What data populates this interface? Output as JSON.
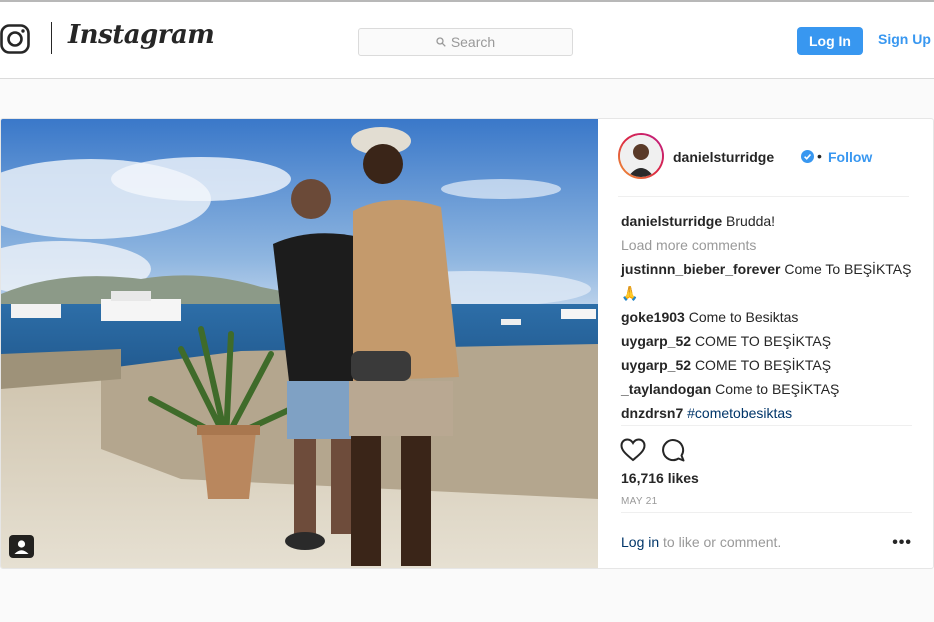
{
  "header": {
    "brand": "Instagram",
    "search_placeholder": "Search",
    "login_label": "Log In",
    "signup_label": "Sign Up"
  },
  "post": {
    "username": "danielsturridge",
    "verified": true,
    "follow_label": "Follow",
    "separator": "•",
    "load_more_label": "Load more comments",
    "comments": [
      {
        "user": "danielsturridge",
        "text": "Brudda!"
      },
      {
        "user": "justinnn_bieber_forever",
        "text": "Come To BEŞİKTAŞ 🙏"
      },
      {
        "user": "goke1903",
        "text": "Come to Besiktas"
      },
      {
        "user": "uygarp_52",
        "text": "COME TO BEŞİKTAŞ"
      },
      {
        "user": "uygarp_52",
        "text": "COME TO BEŞİKTAŞ"
      },
      {
        "user": "_taylandogan",
        "text": "Come to BEŞİKTAŞ"
      },
      {
        "user": "dnzdrsn7",
        "text": "#cometobesiktas"
      }
    ],
    "likes": "16,716 likes",
    "date": "MAY 21",
    "login_link": "Log in",
    "login_suffix": " to like or comment.",
    "more_label": "•••"
  },
  "colors": {
    "accent": "#3897f0",
    "hashtag": "#003569",
    "muted": "#999999",
    "text": "#262626"
  },
  "icons": [
    "instagram-glyph-icon",
    "search-icon",
    "verified-badge-icon",
    "heart-icon",
    "comment-icon",
    "tagged-user-icon",
    "more-options-icon"
  ]
}
